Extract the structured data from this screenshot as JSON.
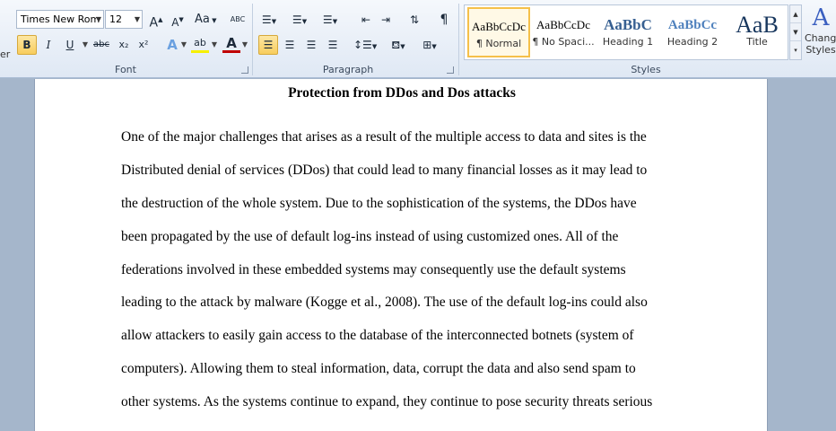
{
  "ribbon": {
    "font": {
      "name": "Times New Rom",
      "size": "12",
      "grow": "A",
      "shrink": "A",
      "change_case": "Aa",
      "clear_format": "ABC",
      "bold": "B",
      "italic": "I",
      "underline": "U",
      "strike": "abc",
      "subscript": "x₂",
      "superscript": "x²",
      "text_effects": "A",
      "highlight": "ab",
      "font_color": "A",
      "label": "Font"
    },
    "paragraph": {
      "label": "Paragraph",
      "pilcrow": "¶"
    },
    "styles": {
      "label": "Styles",
      "items": [
        {
          "sample": "AaBbCcDc",
          "name": "¶ Normal"
        },
        {
          "sample": "AaBbCcDc",
          "name": "¶ No Spaci..."
        },
        {
          "sample": "AaBbC",
          "name": "Heading 1"
        },
        {
          "sample": "AaBbCc",
          "name": "Heading 2"
        },
        {
          "sample": "AaB",
          "name": "Title"
        }
      ],
      "change_styles_icon": "A",
      "change_styles_line1": "Change",
      "change_styles_line2": "Styles"
    },
    "left_cut": "er"
  },
  "document": {
    "title": "Protection from DDos and Dos attacks",
    "lines": [
      " One of the major challenges that arises  as a result of the multiple access to data and sites is the",
      "Distributed denial of services  (DDos) that could lead to many financial losses  as it may lead to",
      "the destruction of the whole system. Due to the sophistication of the systems, the DDos have",
      "been propagated by the use of default log-ins instead of using  customized ones. All of the",
      "federations involved in these embedded systems may consequently use the default systems",
      "leading to the attack by malware (Kogge et al., 2008). The use of the default log-ins could also",
      "allow attackers to easily gain access to the database of the interconnected botnets (system of",
      "computers). Allowing them to steal information, data, corrupt the data and also send spam to",
      "other systems.  As the systems continue to expand, they continue to pose security threats serious"
    ]
  }
}
